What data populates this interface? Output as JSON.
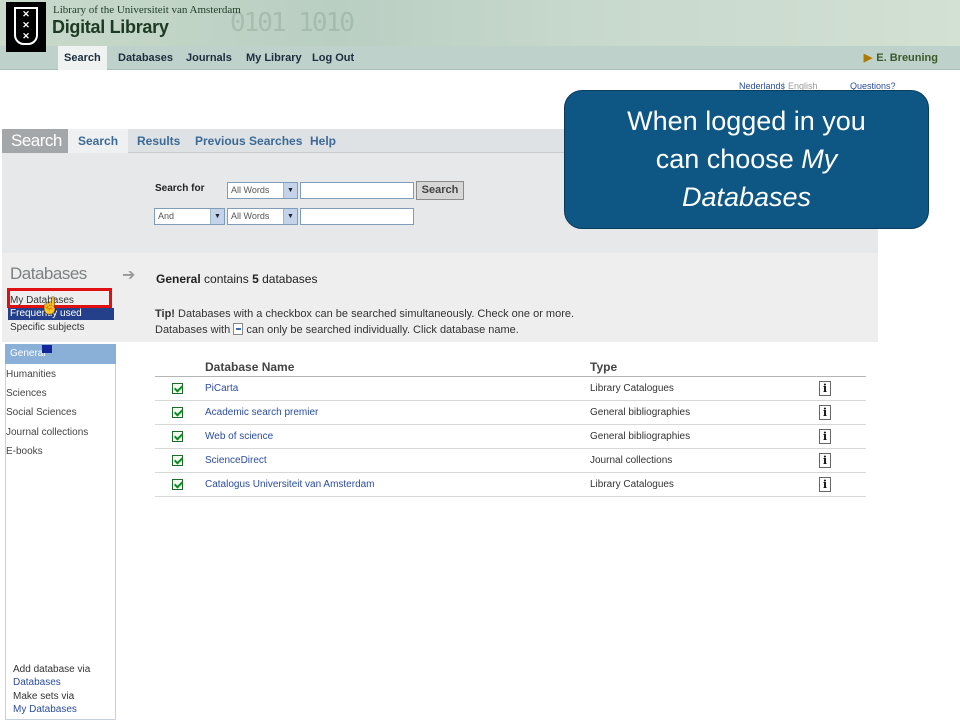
{
  "banner": {
    "line1": "Library of the Universiteit van Amsterdam",
    "line2": "Digital Library"
  },
  "nav": {
    "items": [
      "Search",
      "Databases",
      "Journals",
      "My Library",
      "Log Out"
    ],
    "user": "E. Breuning"
  },
  "lang": {
    "nl": "Nederlands",
    "en": "English",
    "questions": "Questions?"
  },
  "search": {
    "title": "Search",
    "tabs": [
      "Search",
      "Results",
      "Previous Searches",
      "Help"
    ],
    "search_for_label": "Search for",
    "field1": "All Words",
    "op": "And",
    "field2": "All Words",
    "button": "Search"
  },
  "databases": {
    "title": "Databases",
    "my_databases": "My Databases",
    "frequently_used": "Frequently used databases",
    "specific_subjects": "Specific subjects",
    "categories": [
      "General",
      "Humanities",
      "Sciences",
      "Social Sciences",
      "Journal collections",
      "E-books"
    ],
    "general_prefix": "General",
    "general_mid": " contains ",
    "general_count": "5",
    "general_suffix": " databases",
    "tip_label": "Tip!",
    "tip_line1": " Databases with a checkbox can be searched simultaneously. Check one or more.",
    "tip_line2a": "Databases with ",
    "tip_line2b": " can only be searched individually. Click database name.",
    "footer": [
      "Add database via",
      "Databases",
      "Make sets via",
      "My Databases"
    ]
  },
  "table": {
    "col_name": "Database Name",
    "col_type": "Type",
    "rows": [
      {
        "name": "PiCarta",
        "type": "Library Catalogues",
        "checked": true
      },
      {
        "name": "Academic search premier",
        "type": "General bibliographies",
        "checked": true
      },
      {
        "name": "Web of science",
        "type": "General bibliographies",
        "checked": true
      },
      {
        "name": "ScienceDirect",
        "type": "Journal collections",
        "checked": true
      },
      {
        "name": "Catalogus Universiteit van Amsterdam",
        "type": "Library Catalogues",
        "checked": true
      }
    ],
    "info_glyph": "i"
  },
  "callout": {
    "line1": "When logged  in you",
    "line2": "can choose ",
    "line2_em": "My",
    "line3_em": "Databases"
  },
  "colors": {
    "callout_bg": "#0e5785",
    "highlight": "#e01010",
    "selected_item": "#24408a"
  }
}
